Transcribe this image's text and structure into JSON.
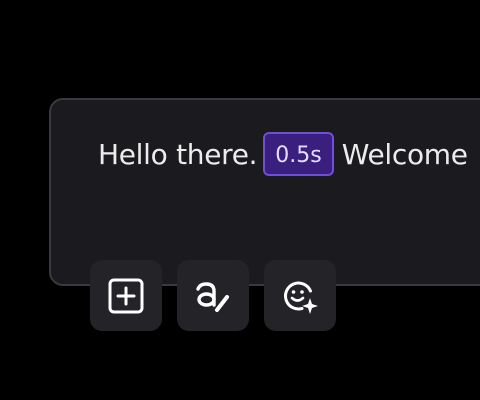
{
  "editor": {
    "segment_1": "Hello there.",
    "pause_badge": "0.5s",
    "segment_2": "Welcome"
  },
  "toolbar": {
    "buttons": [
      {
        "icon": "add-square-icon"
      },
      {
        "icon": "text-style-icon"
      },
      {
        "icon": "emotion-sparkle-icon"
      }
    ]
  },
  "colors": {
    "background": "#000000",
    "card": "#1b1b1f",
    "card_border": "#3a3a3e",
    "text": "#ececec",
    "badge_fill": "#3a1f7e",
    "badge_border": "#6e4fd6",
    "button": "#242428",
    "icon": "#ffffff"
  }
}
